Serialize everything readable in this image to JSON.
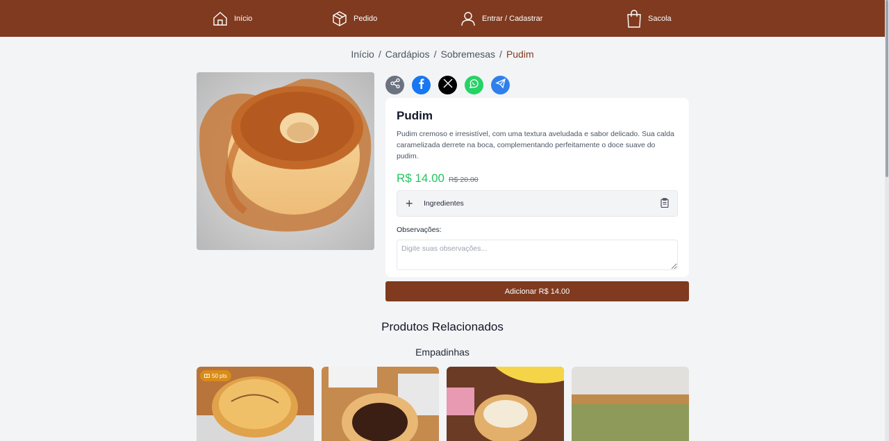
{
  "nav": {
    "items": [
      {
        "label": "Início",
        "icon": "home-icon"
      },
      {
        "label": "Pedido",
        "icon": "box-icon"
      },
      {
        "label": "Entrar / Cadastrar",
        "icon": "user-icon"
      },
      {
        "label": "Sacola",
        "icon": "bag-icon"
      }
    ]
  },
  "breadcrumb": {
    "items": [
      "Início",
      "Cardápios",
      "Sobremesas"
    ],
    "separator": "/",
    "current": "Pudim"
  },
  "share": {
    "icons": [
      "share-icon",
      "facebook-icon",
      "x-icon",
      "whatsapp-icon",
      "telegram-icon"
    ]
  },
  "product": {
    "name": "Pudim",
    "description": "Pudim cremoso e irresistível, com uma textura aveludada e sabor delicado. Sua calda caramelizada derrete na boca, complementando perfeitamente o doce suave do pudim.",
    "price": "R$ 14.00",
    "old_price": "R$ 20.00",
    "ingredients_label": "Ingredientes",
    "observations_label": "Observações:",
    "observations_placeholder": "Digite suas observações...",
    "add_button_label": "Adicionar R$ 14.00"
  },
  "related": {
    "title": "Produtos Relacionados",
    "category": "Empadinhas",
    "points_badge": "50 pts"
  },
  "colors": {
    "brand": "#7f3a1f",
    "price": "#22c55e",
    "badge": "#d98c1a"
  }
}
